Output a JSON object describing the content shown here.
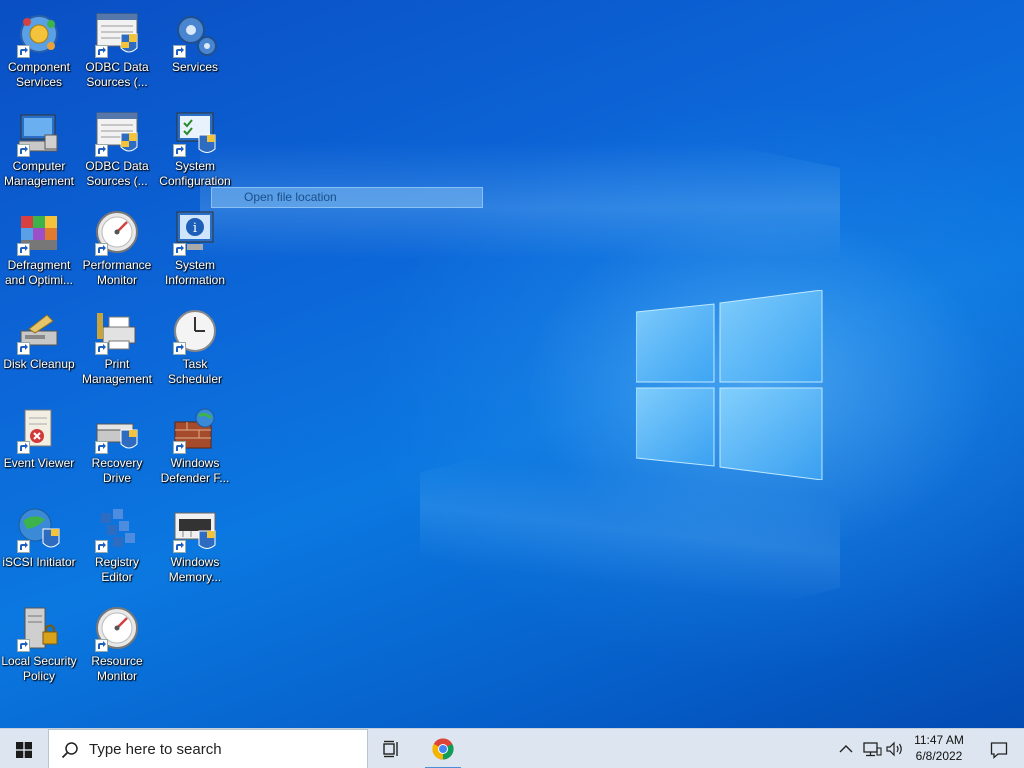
{
  "desktop": {
    "icons": [
      {
        "label": "Component Services",
        "icon": "component-services-icon"
      },
      {
        "label": "ODBC Data Sources (...",
        "icon": "odbc-icon"
      },
      {
        "label": "Services",
        "icon": "gears-icon"
      },
      {
        "label": "Computer Management",
        "icon": "computer-management-icon"
      },
      {
        "label": "ODBC Data Sources (...",
        "icon": "odbc-icon"
      },
      {
        "label": "System Configuration",
        "icon": "system-configuration-icon"
      },
      {
        "label": "Defragment and Optimi...",
        "icon": "defragment-icon"
      },
      {
        "label": "Performance Monitor",
        "icon": "gauge-icon"
      },
      {
        "label": "System Information",
        "icon": "system-information-icon"
      },
      {
        "label": "Disk Cleanup",
        "icon": "disk-cleanup-icon"
      },
      {
        "label": "Print Management",
        "icon": "printer-icon"
      },
      {
        "label": "Task Scheduler",
        "icon": "clock-icon"
      },
      {
        "label": "Event Viewer",
        "icon": "event-viewer-icon"
      },
      {
        "label": "Recovery Drive",
        "icon": "recovery-drive-icon"
      },
      {
        "label": "Windows Defender F...",
        "icon": "firewall-icon"
      },
      {
        "label": "iSCSI Initiator",
        "icon": "globe-shield-icon"
      },
      {
        "label": "Registry Editor",
        "icon": "registry-icon"
      },
      {
        "label": "Windows Memory...",
        "icon": "memory-chip-icon"
      },
      {
        "label": "Local Security Policy",
        "icon": "server-lock-icon"
      },
      {
        "label": "Resource Monitor",
        "icon": "gauge-icon"
      }
    ]
  },
  "context_menu": {
    "item": "Open file location"
  },
  "taskbar": {
    "search_placeholder": "Type here to search",
    "clock_time": "11:47 AM",
    "clock_date": "6/8/2022"
  },
  "colors": {
    "accent": "#0b78e0",
    "taskbar": "#dde6f0"
  }
}
